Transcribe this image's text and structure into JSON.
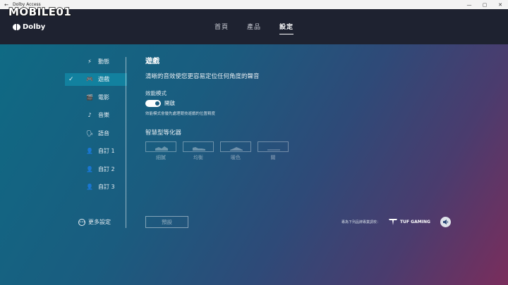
{
  "window": {
    "title": "Dolby Access",
    "back_glyph": "←",
    "min_glyph": "—",
    "max_glyph": "▢",
    "close_glyph": "✕"
  },
  "watermark": "MOBILE01",
  "brand": {
    "logo_text": "Dolby"
  },
  "nav": {
    "tabs": [
      "首頁",
      "產品",
      "設定"
    ],
    "active": 2
  },
  "sidebar": {
    "items": [
      {
        "label": "動態",
        "icon": "lightning-icon",
        "glyph": "⚡"
      },
      {
        "label": "遊戲",
        "icon": "gamepad-icon",
        "glyph": "🎮",
        "active": true
      },
      {
        "label": "電影",
        "icon": "clapper-icon",
        "glyph": "🎬"
      },
      {
        "label": "音樂",
        "icon": "music-note-icon",
        "glyph": "♪"
      },
      {
        "label": "語音",
        "icon": "speaking-person-icon",
        "glyph": "🗣"
      },
      {
        "label": "自訂 1",
        "icon": "person-icon",
        "glyph": "👤"
      },
      {
        "label": "自訂 2",
        "icon": "person-icon",
        "glyph": "👤"
      },
      {
        "label": "自訂 3",
        "icon": "person-icon",
        "glyph": "👤"
      }
    ],
    "check_glyph": "✓",
    "more": {
      "label": "更多設定",
      "icon": "more-dots-icon",
      "glyph": "•••"
    }
  },
  "content": {
    "title": "遊戲",
    "description": "清晰的音效使您更容易定位任何角度的聲音",
    "performance": {
      "label": "效能模式",
      "toggle_state": "開啟",
      "note": "效能模式會優先處理競技遊戲的位置精度"
    },
    "eq": {
      "heading": "智慧型等化器",
      "presets": [
        {
          "label": "細膩",
          "icon": "eq-detailed-icon"
        },
        {
          "label": "均衡",
          "icon": "eq-balanced-icon"
        },
        {
          "label": "暖色",
          "icon": "eq-warm-icon"
        },
        {
          "label": "關",
          "icon": "eq-off-icon"
        }
      ]
    },
    "reset_label": "預設"
  },
  "footer": {
    "tuned_text": "專為下列品牌專業調校：",
    "partner": "TUF GAMING"
  },
  "colors": {
    "header_bg": "#1e2230",
    "accent": "#12819f"
  }
}
